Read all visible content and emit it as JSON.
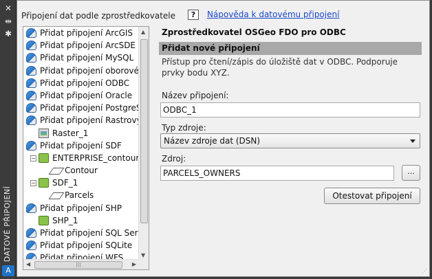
{
  "palette": {
    "title": "DATOVÉ PŘIPOJENÍ",
    "icons": [
      "close-icon",
      "auto-hide-icon",
      "settings-icon"
    ],
    "logo": "A"
  },
  "left": {
    "header": "Připojení dat podle zprostředkovatele",
    "tree": [
      {
        "label": "Přidat připojení ArcGIS",
        "icon": "add-connection-icon",
        "level": 0
      },
      {
        "label": "Přidat připojení ArcSDE",
        "icon": "add-connection-icon",
        "level": 0
      },
      {
        "label": "Přidat připojení MySQL",
        "icon": "add-connection-icon",
        "level": 0
      },
      {
        "label": "Přidat připojení oborového",
        "icon": "add-connection-icon",
        "level": 0
      },
      {
        "label": "Přidat připojení ODBC",
        "icon": "add-connection-icon",
        "level": 0
      },
      {
        "label": "Přidat připojení Oracle",
        "icon": "add-connection-icon",
        "level": 0
      },
      {
        "label": "Přidat připojení PostgreSQL",
        "icon": "add-connection-icon",
        "level": 0
      },
      {
        "label": "Přidat připojení Rastrový ob",
        "icon": "add-connection-icon",
        "level": 0
      },
      {
        "label": "Raster_1",
        "icon": "raster-icon",
        "level": 1
      },
      {
        "label": "Přidat připojení SDF",
        "icon": "add-connection-icon",
        "level": 0
      },
      {
        "label": "ENTERPRISE_contour",
        "icon": "layer-icon",
        "level": 1,
        "toggle": "−"
      },
      {
        "label": "Contour",
        "icon": "feature-class-icon",
        "level": 2
      },
      {
        "label": "SDF_1",
        "icon": "layer-icon",
        "level": 1,
        "toggle": "−"
      },
      {
        "label": "Parcels",
        "icon": "feature-class-icon",
        "level": 2
      },
      {
        "label": "Přidat připojení SHP",
        "icon": "add-connection-icon",
        "level": 0
      },
      {
        "label": "SHP_1",
        "icon": "layer-icon",
        "level": 1
      },
      {
        "label": "Přidat připojení SQL Server",
        "icon": "add-connection-icon",
        "level": 0
      },
      {
        "label": "Přidat připojení SQLite",
        "icon": "add-connection-icon",
        "level": 0
      },
      {
        "label": "Přidat připojení WFS",
        "icon": "add-connection-icon",
        "level": 0
      }
    ]
  },
  "help": {
    "icon_text": "?",
    "link": "Nápověda k datovému připojení"
  },
  "right": {
    "provider_title": "Zprostředkovatel OSGeo FDO pro ODBC",
    "section_title": "Přidat nové připojení",
    "description": "Přístup pro čtení/zápis do úložiště dat v ODBC. Podporuje prvky bodu XYZ.",
    "connection_name_label": "Název připojení:",
    "connection_name_value": "ODBC_1",
    "source_type_label": "Typ zdroje:",
    "source_type_value": "Název zdroje dat (DSN)",
    "source_label": "Zdroj:",
    "source_value": "PARCELS_OWNERS",
    "browse_label": "...",
    "test_button": "Otestovat připojení"
  }
}
